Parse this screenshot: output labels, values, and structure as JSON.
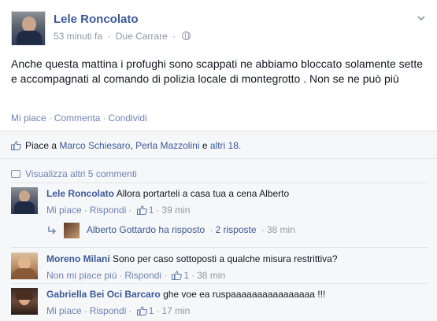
{
  "post": {
    "author": "Lele Roncolato",
    "time": "53 minuti fa",
    "location": "Due Carrare",
    "text": "Anche questa mattina i profughi sono scappati ne abbiamo bloccato solamente sette e accompagnati al comando di polizia locale di montegrotto . Non se ne può più",
    "actions": {
      "like": "Mi piace",
      "comment": "Commenta",
      "share": "Condividi"
    }
  },
  "likes": {
    "prefix": "Piace a",
    "name1": "Marco Schiesaro",
    "name2": "Perla Mazzolini",
    "conj": "e",
    "others": "altri 18."
  },
  "view_more": "Visualizza altri 5 commenti",
  "comments": [
    {
      "author": "Lele Roncolato",
      "text": "Allora portarteli a casa tua a cena Alberto",
      "like_label": "Mi piace",
      "reply_label": "Rispondi",
      "like_count": "1",
      "time": "39 min"
    },
    {
      "author": "Moreno Milani",
      "text": "Sono per caso sottoposti a qualche misura restrittiva?",
      "like_label": "Non mi piace più",
      "reply_label": "Rispondi",
      "like_count": "1",
      "time": "38 min"
    },
    {
      "author": "Gabriella Bei Oci Barcaro",
      "text": "ghe voe ea ruspaaaaaaaaaaaaaaaa !!!",
      "like_label": "Mi piace",
      "reply_label": "Rispondi",
      "like_count": "1",
      "time": "17 min"
    }
  ],
  "reply": {
    "author": "Alberto Gottardo",
    "action": "ha risposto",
    "count": "2 risposte",
    "time": "38 min"
  },
  "colors": {
    "link": "#3b5998",
    "muted": "#9197a3",
    "action": "#6d84b4"
  }
}
